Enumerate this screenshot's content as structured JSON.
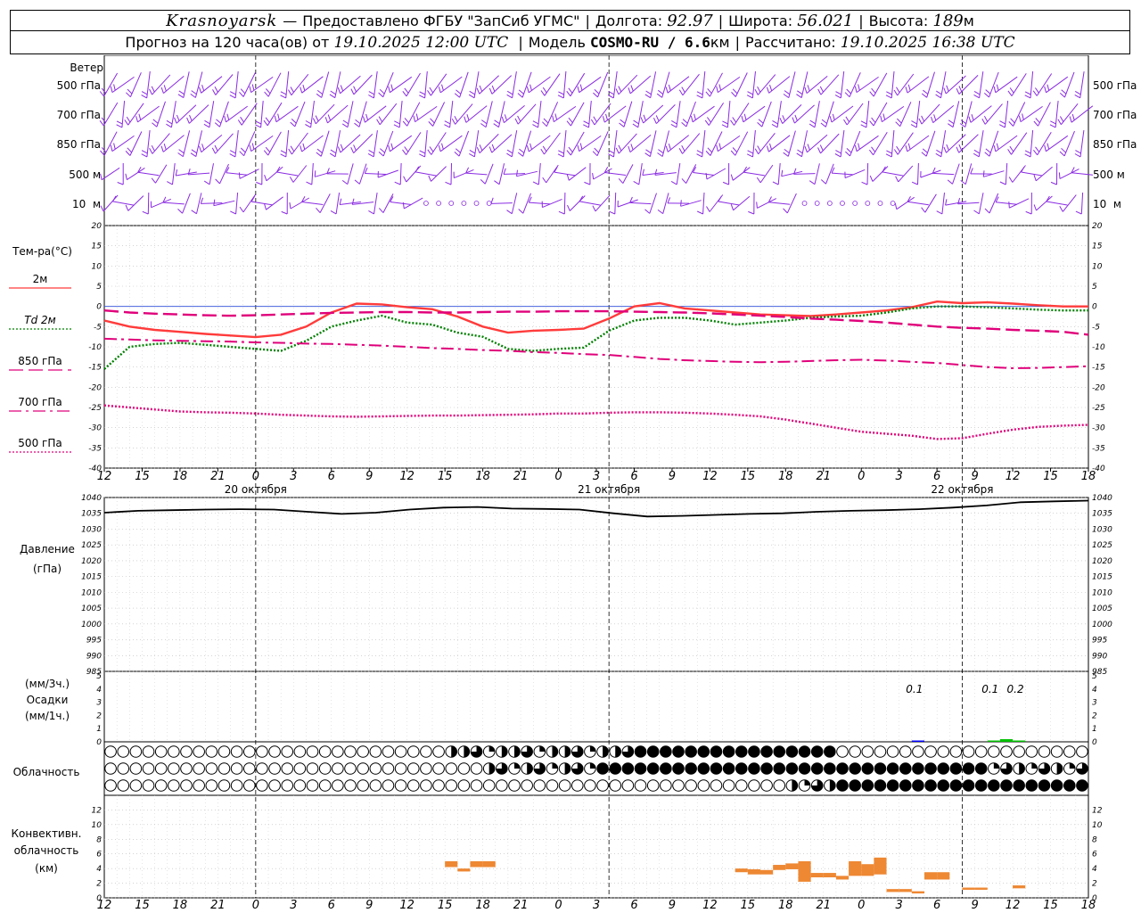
{
  "header": {
    "line1": {
      "city": "Krasnoyarsk",
      "dash": "—",
      "provider": "Предоставлено ФГБУ \"ЗапСиб УГМС\"",
      "lon_label": "Долгота:",
      "lon_value": "92.97",
      "lat_label": "Широта:",
      "lat_value": "56.021",
      "alt_label": "Высота:",
      "alt_value": "189",
      "alt_unit": "м"
    },
    "line2": {
      "forecast_label": "Прогноз на 120 часа(ов) от",
      "forecast_date": "19.10.2025 12:00 UTC",
      "model_label": "Модель",
      "model_name": "COSMO-RU / 6.6",
      "model_unit": "км",
      "calc_label": "Рассчитано:",
      "calc_date": "19.10.2025 16:38 UTC"
    }
  },
  "panels": {
    "wind": {
      "title": "Ветер",
      "levels": [
        "500 гПа",
        "700 гПа",
        "850 гПа",
        "500 м",
        "10  м"
      ]
    },
    "temp": {
      "title": "Тем-ра(°С)",
      "legend": [
        {
          "label": "2м",
          "color": "#ff3b3b",
          "style": "solid"
        },
        {
          "label": "Td  2м",
          "color": "#008000",
          "style": "dotted"
        },
        {
          "label": "850 гПа",
          "color": "#e0007a",
          "style": "longdash"
        },
        {
          "label": "700 гПа",
          "color": "#e0007a",
          "style": "dashdot"
        },
        {
          "label": "500 гПа",
          "color": "#e0007a",
          "style": "dotted"
        }
      ]
    },
    "pressure": {
      "title": "Давление",
      "unit": "(гПа)"
    },
    "precip": {
      "title_unit1": "(мм/3ч.)",
      "title": "Осадки",
      "title_unit2": "(мм/1ч.)"
    },
    "cloud": {
      "title": "Облачность"
    },
    "conv": {
      "title1": "Конвективн.",
      "title2": "облачность",
      "title3": "(км)"
    }
  },
  "time_axis": {
    "labels": [
      "12",
      "15",
      "18",
      "21",
      "0",
      "3",
      "6",
      "9",
      "12",
      "15",
      "18",
      "21",
      "0",
      "3",
      "6",
      "9",
      "12",
      "15",
      "18",
      "21",
      "0",
      "3",
      "6",
      "9",
      "12",
      "15",
      "18"
    ],
    "dates": [
      "20 октября",
      "21 октября",
      "22 октября"
    ]
  },
  "chart_data": [
    {
      "type": "line",
      "title": "Тем-ра(°С)",
      "x_hours": [
        0,
        6,
        12,
        18,
        24,
        30,
        36,
        42,
        48,
        54,
        60,
        66,
        72,
        78,
        84,
        90,
        96,
        102,
        108,
        114,
        120,
        126,
        132,
        138,
        144,
        150,
        156,
        162,
        168,
        174,
        180,
        186,
        192,
        198,
        204,
        210,
        216,
        222,
        228,
        234
      ],
      "ylim": [
        -40,
        20
      ],
      "y_ticks": [
        20,
        15,
        10,
        5,
        0,
        -5,
        -10,
        -15,
        -20,
        -25,
        -30,
        -35,
        -40
      ],
      "series": [
        {
          "name": "2м",
          "color": "#ff3b3b",
          "values": [
            -3.5,
            -5,
            -5.8,
            -6.3,
            -6.8,
            -7.2,
            -7.6,
            -7,
            -5,
            -1.5,
            0.7,
            0.5,
            -0.2,
            -0.7,
            -2.5,
            -5,
            -6.5,
            -6,
            -5.8,
            -5.5,
            -3,
            0,
            0.8,
            -0.5,
            -1,
            -1.5,
            -2,
            -2.2,
            -2.4,
            -2,
            -1.5,
            -1,
            -0.2,
            1.2,
            0.8,
            1,
            0.7,
            0.3,
            0,
            0
          ]
        },
        {
          "name": "Td 2м",
          "color": "#008000",
          "values": [
            -15.5,
            -10,
            -9.3,
            -9,
            -9.5,
            -10,
            -10.5,
            -11,
            -8.5,
            -5,
            -3.5,
            -2.3,
            -4,
            -4.5,
            -6.5,
            -7.5,
            -10.5,
            -11,
            -10.5,
            -10.2,
            -6,
            -3.5,
            -2.8,
            -2.8,
            -3.5,
            -4.5,
            -4,
            -3.5,
            -2.8,
            -2.5,
            -2.3,
            -1.5,
            -0.5,
            0,
            0,
            -0.2,
            -0.5,
            -0.8,
            -1,
            -1
          ]
        },
        {
          "name": "850 гПа",
          "color": "#e0007a",
          "values": [
            -1,
            -1.5,
            -1.8,
            -2,
            -2.2,
            -2.3,
            -2.2,
            -2,
            -1.8,
            -1.6,
            -1.5,
            -1.4,
            -1.4,
            -1.5,
            -1.5,
            -1.4,
            -1.3,
            -1.3,
            -1.2,
            -1.2,
            -1.2,
            -1.3,
            -1.4,
            -1.5,
            -1.7,
            -2,
            -2.3,
            -2.6,
            -3,
            -3.3,
            -3.6,
            -4,
            -4.5,
            -5,
            -5.3,
            -5.5,
            -5.8,
            -6,
            -6.3,
            -7
          ]
        },
        {
          "name": "700 гПа",
          "color": "#e0007a",
          "values": [
            -8,
            -8.2,
            -8.4,
            -8.5,
            -8.6,
            -8.7,
            -8.9,
            -9,
            -9.2,
            -9.3,
            -9.5,
            -9.7,
            -10,
            -10.3,
            -10.5,
            -10.8,
            -11,
            -11.3,
            -11.5,
            -11.8,
            -12,
            -12.5,
            -13,
            -13.3,
            -13.5,
            -13.7,
            -13.8,
            -13.7,
            -13.5,
            -13.3,
            -13.2,
            -13.4,
            -13.7,
            -14,
            -14.5,
            -15,
            -15.3,
            -15.2,
            -15,
            -14.8
          ]
        },
        {
          "name": "500 гПа",
          "color": "#e0007a",
          "values": [
            -24.5,
            -25,
            -25.5,
            -26,
            -26.2,
            -26.3,
            -26.5,
            -26.8,
            -27,
            -27.2,
            -27.3,
            -27.2,
            -27.1,
            -27,
            -27,
            -26.9,
            -26.8,
            -26.7,
            -26.5,
            -26.5,
            -26.3,
            -26.2,
            -26.2,
            -26.3,
            -26.5,
            -26.8,
            -27.2,
            -28,
            -29,
            -30,
            -31,
            -31.5,
            -32,
            -32.8,
            -32.6,
            -31.5,
            -30.5,
            -29.8,
            -29.5,
            -29.3
          ]
        }
      ]
    },
    {
      "type": "line",
      "title": "Давление (гПа)",
      "ylim": [
        985,
        1040
      ],
      "y_ticks": [
        1040,
        1035,
        1030,
        1025,
        1020,
        1015,
        1010,
        1005,
        1000,
        995,
        990,
        985
      ],
      "series": [
        {
          "name": "Давление",
          "color": "#000000",
          "values": [
            1035.2,
            1035.8,
            1036,
            1036.2,
            1036.3,
            1036.2,
            1035.5,
            1034.8,
            1035.2,
            1036.2,
            1036.8,
            1037,
            1036.5,
            1036.4,
            1036.2,
            1035,
            1034,
            1034.2,
            1034.5,
            1034.8,
            1035,
            1035.5,
            1035.8,
            1036,
            1036.3,
            1036.8,
            1037.5,
            1038.5,
            1038.8,
            1039
          ]
        }
      ]
    },
    {
      "type": "bar",
      "title": "Осадки",
      "ylim": [
        0,
        5
      ],
      "y_ticks": [
        5,
        4,
        3,
        2,
        1,
        0
      ],
      "annotations": [
        "0.1",
        "0.1",
        "0.2"
      ],
      "bars": [
        {
          "hour": 192,
          "value": 0.1,
          "color": "#0000ff"
        },
        {
          "hour": 210,
          "value": 0.1,
          "color": "#00c000"
        },
        {
          "hour": 213,
          "value": 0.2,
          "color": "#00c000"
        },
        {
          "hour": 216,
          "value": 0.1,
          "color": "#00c000"
        }
      ]
    },
    {
      "type": "bar",
      "title": "Конвективн. облачность (км)",
      "ylim": [
        0,
        14
      ],
      "y_ticks": [
        12,
        10,
        8,
        6,
        4,
        2,
        0
      ],
      "bars": [
        {
          "hour": 81,
          "low": 4.2,
          "high": 5
        },
        {
          "hour": 84,
          "low": 3.6,
          "high": 4
        },
        {
          "hour": 87,
          "low": 4.2,
          "high": 5
        },
        {
          "hour": 90,
          "low": 4.2,
          "high": 5
        },
        {
          "hour": 150,
          "low": 3.5,
          "high": 4
        },
        {
          "hour": 153,
          "low": 3.2,
          "high": 3.9
        },
        {
          "hour": 156,
          "low": 3.2,
          "high": 3.8
        },
        {
          "hour": 159,
          "low": 3.8,
          "high": 4.5
        },
        {
          "hour": 162,
          "low": 3.9,
          "high": 4.7
        },
        {
          "hour": 165,
          "low": 2.2,
          "high": 5
        },
        {
          "hour": 168,
          "low": 2.8,
          "high": 3.4
        },
        {
          "hour": 171,
          "low": 2.8,
          "high": 3.4
        },
        {
          "hour": 174,
          "low": 2.5,
          "high": 3
        },
        {
          "hour": 177,
          "low": 3,
          "high": 5
        },
        {
          "hour": 180,
          "low": 3,
          "high": 4.6
        },
        {
          "hour": 183,
          "low": 3.2,
          "high": 5.5
        },
        {
          "hour": 186,
          "low": 0.8,
          "high": 1.2
        },
        {
          "hour": 189,
          "low": 0.8,
          "high": 1.2
        },
        {
          "hour": 192,
          "low": 0.6,
          "high": 0.9
        },
        {
          "hour": 195,
          "low": 2.5,
          "high": 3.5
        },
        {
          "hour": 198,
          "low": 2.5,
          "high": 3.5
        },
        {
          "hour": 204,
          "low": 1.1,
          "high": 1.4
        },
        {
          "hour": 207,
          "low": 1.1,
          "high": 1.4
        },
        {
          "hour": 216,
          "low": 1.3,
          "high": 1.7
        }
      ]
    }
  ],
  "colors": {
    "grid": "#000000",
    "wind": "#8a2be2",
    "conv": "#ee8833"
  }
}
